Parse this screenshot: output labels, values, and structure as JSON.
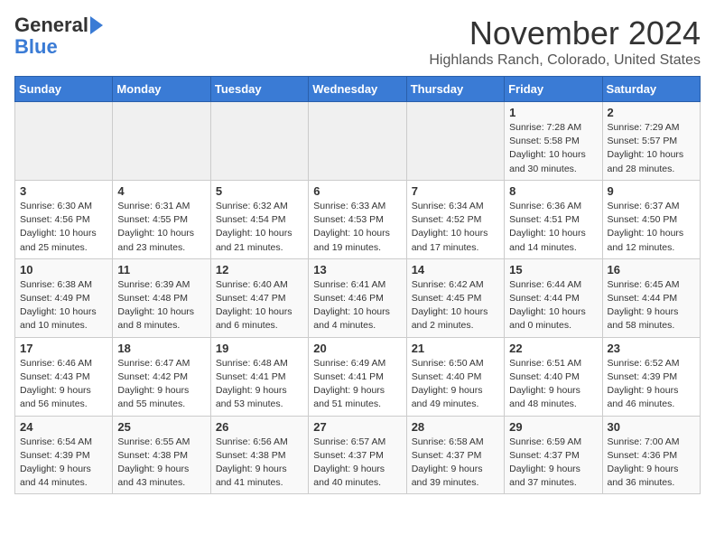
{
  "logo": {
    "line1": "General",
    "line2": "Blue"
  },
  "title": "November 2024",
  "location": "Highlands Ranch, Colorado, United States",
  "weekdays": [
    "Sunday",
    "Monday",
    "Tuesday",
    "Wednesday",
    "Thursday",
    "Friday",
    "Saturday"
  ],
  "weeks": [
    [
      {
        "day": "",
        "info": ""
      },
      {
        "day": "",
        "info": ""
      },
      {
        "day": "",
        "info": ""
      },
      {
        "day": "",
        "info": ""
      },
      {
        "day": "",
        "info": ""
      },
      {
        "day": "1",
        "info": "Sunrise: 7:28 AM\nSunset: 5:58 PM\nDaylight: 10 hours\nand 30 minutes."
      },
      {
        "day": "2",
        "info": "Sunrise: 7:29 AM\nSunset: 5:57 PM\nDaylight: 10 hours\nand 28 minutes."
      }
    ],
    [
      {
        "day": "3",
        "info": "Sunrise: 6:30 AM\nSunset: 4:56 PM\nDaylight: 10 hours\nand 25 minutes."
      },
      {
        "day": "4",
        "info": "Sunrise: 6:31 AM\nSunset: 4:55 PM\nDaylight: 10 hours\nand 23 minutes."
      },
      {
        "day": "5",
        "info": "Sunrise: 6:32 AM\nSunset: 4:54 PM\nDaylight: 10 hours\nand 21 minutes."
      },
      {
        "day": "6",
        "info": "Sunrise: 6:33 AM\nSunset: 4:53 PM\nDaylight: 10 hours\nand 19 minutes."
      },
      {
        "day": "7",
        "info": "Sunrise: 6:34 AM\nSunset: 4:52 PM\nDaylight: 10 hours\nand 17 minutes."
      },
      {
        "day": "8",
        "info": "Sunrise: 6:36 AM\nSunset: 4:51 PM\nDaylight: 10 hours\nand 14 minutes."
      },
      {
        "day": "9",
        "info": "Sunrise: 6:37 AM\nSunset: 4:50 PM\nDaylight: 10 hours\nand 12 minutes."
      }
    ],
    [
      {
        "day": "10",
        "info": "Sunrise: 6:38 AM\nSunset: 4:49 PM\nDaylight: 10 hours\nand 10 minutes."
      },
      {
        "day": "11",
        "info": "Sunrise: 6:39 AM\nSunset: 4:48 PM\nDaylight: 10 hours\nand 8 minutes."
      },
      {
        "day": "12",
        "info": "Sunrise: 6:40 AM\nSunset: 4:47 PM\nDaylight: 10 hours\nand 6 minutes."
      },
      {
        "day": "13",
        "info": "Sunrise: 6:41 AM\nSunset: 4:46 PM\nDaylight: 10 hours\nand 4 minutes."
      },
      {
        "day": "14",
        "info": "Sunrise: 6:42 AM\nSunset: 4:45 PM\nDaylight: 10 hours\nand 2 minutes."
      },
      {
        "day": "15",
        "info": "Sunrise: 6:44 AM\nSunset: 4:44 PM\nDaylight: 10 hours\nand 0 minutes."
      },
      {
        "day": "16",
        "info": "Sunrise: 6:45 AM\nSunset: 4:44 PM\nDaylight: 9 hours\nand 58 minutes."
      }
    ],
    [
      {
        "day": "17",
        "info": "Sunrise: 6:46 AM\nSunset: 4:43 PM\nDaylight: 9 hours\nand 56 minutes."
      },
      {
        "day": "18",
        "info": "Sunrise: 6:47 AM\nSunset: 4:42 PM\nDaylight: 9 hours\nand 55 minutes."
      },
      {
        "day": "19",
        "info": "Sunrise: 6:48 AM\nSunset: 4:41 PM\nDaylight: 9 hours\nand 53 minutes."
      },
      {
        "day": "20",
        "info": "Sunrise: 6:49 AM\nSunset: 4:41 PM\nDaylight: 9 hours\nand 51 minutes."
      },
      {
        "day": "21",
        "info": "Sunrise: 6:50 AM\nSunset: 4:40 PM\nDaylight: 9 hours\nand 49 minutes."
      },
      {
        "day": "22",
        "info": "Sunrise: 6:51 AM\nSunset: 4:40 PM\nDaylight: 9 hours\nand 48 minutes."
      },
      {
        "day": "23",
        "info": "Sunrise: 6:52 AM\nSunset: 4:39 PM\nDaylight: 9 hours\nand 46 minutes."
      }
    ],
    [
      {
        "day": "24",
        "info": "Sunrise: 6:54 AM\nSunset: 4:39 PM\nDaylight: 9 hours\nand 44 minutes."
      },
      {
        "day": "25",
        "info": "Sunrise: 6:55 AM\nSunset: 4:38 PM\nDaylight: 9 hours\nand 43 minutes."
      },
      {
        "day": "26",
        "info": "Sunrise: 6:56 AM\nSunset: 4:38 PM\nDaylight: 9 hours\nand 41 minutes."
      },
      {
        "day": "27",
        "info": "Sunrise: 6:57 AM\nSunset: 4:37 PM\nDaylight: 9 hours\nand 40 minutes."
      },
      {
        "day": "28",
        "info": "Sunrise: 6:58 AM\nSunset: 4:37 PM\nDaylight: 9 hours\nand 39 minutes."
      },
      {
        "day": "29",
        "info": "Sunrise: 6:59 AM\nSunset: 4:37 PM\nDaylight: 9 hours\nand 37 minutes."
      },
      {
        "day": "30",
        "info": "Sunrise: 7:00 AM\nSunset: 4:36 PM\nDaylight: 9 hours\nand 36 minutes."
      }
    ]
  ]
}
